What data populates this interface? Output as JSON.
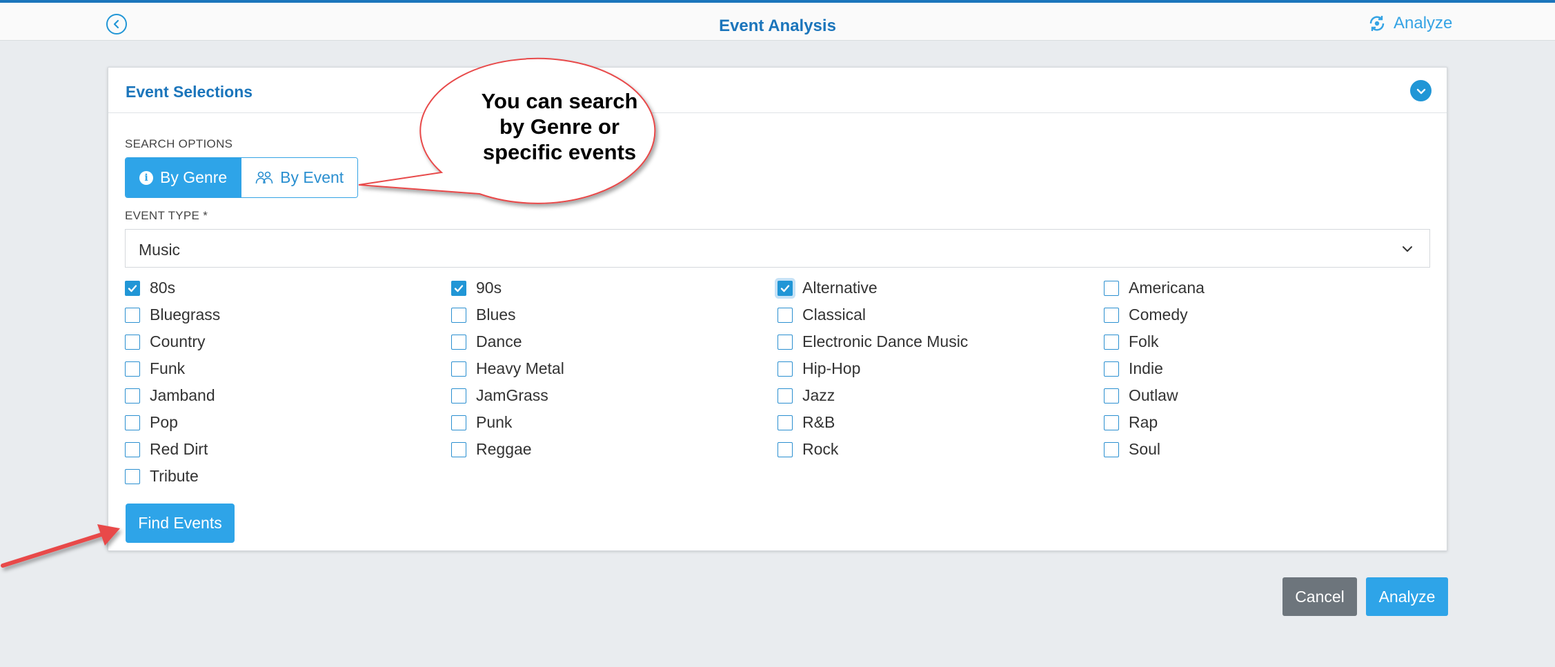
{
  "header": {
    "title": "Event Analysis",
    "analyze_label": "Analyze"
  },
  "panel": {
    "title": "Event Selections",
    "search_options_label": "SEARCH OPTIONS",
    "search_tabs": [
      "By Genre",
      "By Event"
    ],
    "active_tab": "By Genre",
    "event_type_label": "EVENT TYPE *",
    "event_type_value": "Music",
    "genres": [
      {
        "label": "80s",
        "checked": true
      },
      {
        "label": "90s",
        "checked": true
      },
      {
        "label": "Alternative",
        "checked": true
      },
      {
        "label": "Americana",
        "checked": false
      },
      {
        "label": "Bluegrass",
        "checked": false
      },
      {
        "label": "Blues",
        "checked": false
      },
      {
        "label": "Classical",
        "checked": false
      },
      {
        "label": "Comedy",
        "checked": false
      },
      {
        "label": "Country",
        "checked": false
      },
      {
        "label": "Dance",
        "checked": false
      },
      {
        "label": "Electronic Dance Music",
        "checked": false
      },
      {
        "label": "Folk",
        "checked": false
      },
      {
        "label": "Funk",
        "checked": false
      },
      {
        "label": "Heavy Metal",
        "checked": false
      },
      {
        "label": "Hip-Hop",
        "checked": false
      },
      {
        "label": "Indie",
        "checked": false
      },
      {
        "label": "Jamband",
        "checked": false
      },
      {
        "label": "JamGrass",
        "checked": false
      },
      {
        "label": "Jazz",
        "checked": false
      },
      {
        "label": "Outlaw",
        "checked": false
      },
      {
        "label": "Pop",
        "checked": false
      },
      {
        "label": "Punk",
        "checked": false
      },
      {
        "label": "R&B",
        "checked": false
      },
      {
        "label": "Rap",
        "checked": false
      },
      {
        "label": "Red Dirt",
        "checked": false
      },
      {
        "label": "Reggae",
        "checked": false
      },
      {
        "label": "Rock",
        "checked": false
      },
      {
        "label": "Soul",
        "checked": false
      },
      {
        "label": "Tribute",
        "checked": false
      }
    ],
    "find_button_label": "Find Events"
  },
  "footer": {
    "cancel_label": "Cancel",
    "analyze_label": "Analyze"
  },
  "annotation": {
    "callout_text": "You can search\nby Genre or\nspecific events"
  },
  "colors": {
    "accent": "#2ea4e8",
    "title_blue": "#1b75bb",
    "cancel_gray": "#6d757c",
    "annotation_red": "#e8484a"
  }
}
